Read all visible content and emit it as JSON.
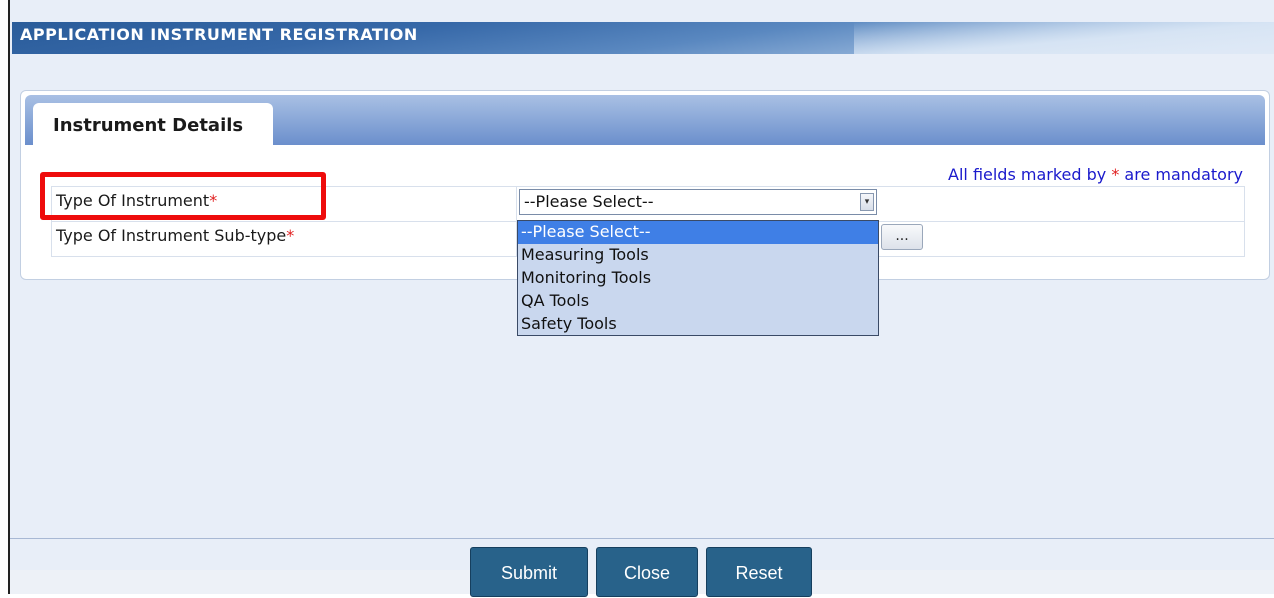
{
  "header": {
    "title": "APPLICATION INSTRUMENT REGISTRATION"
  },
  "tabs": {
    "active_label": "Instrument Details"
  },
  "form": {
    "mandatory_note_prefix": "All fields marked by ",
    "mandatory_note_star": "*",
    "mandatory_note_suffix": " are mandatory",
    "fields": [
      {
        "label": "Type Of Instrument",
        "required_mark": "*",
        "value": "--Please Select--"
      },
      {
        "label": "Type Of Instrument Sub-type",
        "required_mark": "*",
        "button_label": "..."
      }
    ]
  },
  "dropdown": {
    "options": [
      "--Please Select--",
      "Measuring Tools",
      "Monitoring Tools",
      "QA Tools",
      "Safety Tools"
    ],
    "selected_index": 0
  },
  "footer": {
    "submit_label": "Submit",
    "close_label": "Close",
    "reset_label": "Reset"
  },
  "colors": {
    "title_bar": "#2a5c9a",
    "tab_header": "#6b8fcc",
    "button": "#28628a",
    "highlight": "#ee0c0c",
    "required_star": "#e02020",
    "note_text": "#1a1acc",
    "dropdown_selected": "#3f7fe6"
  }
}
